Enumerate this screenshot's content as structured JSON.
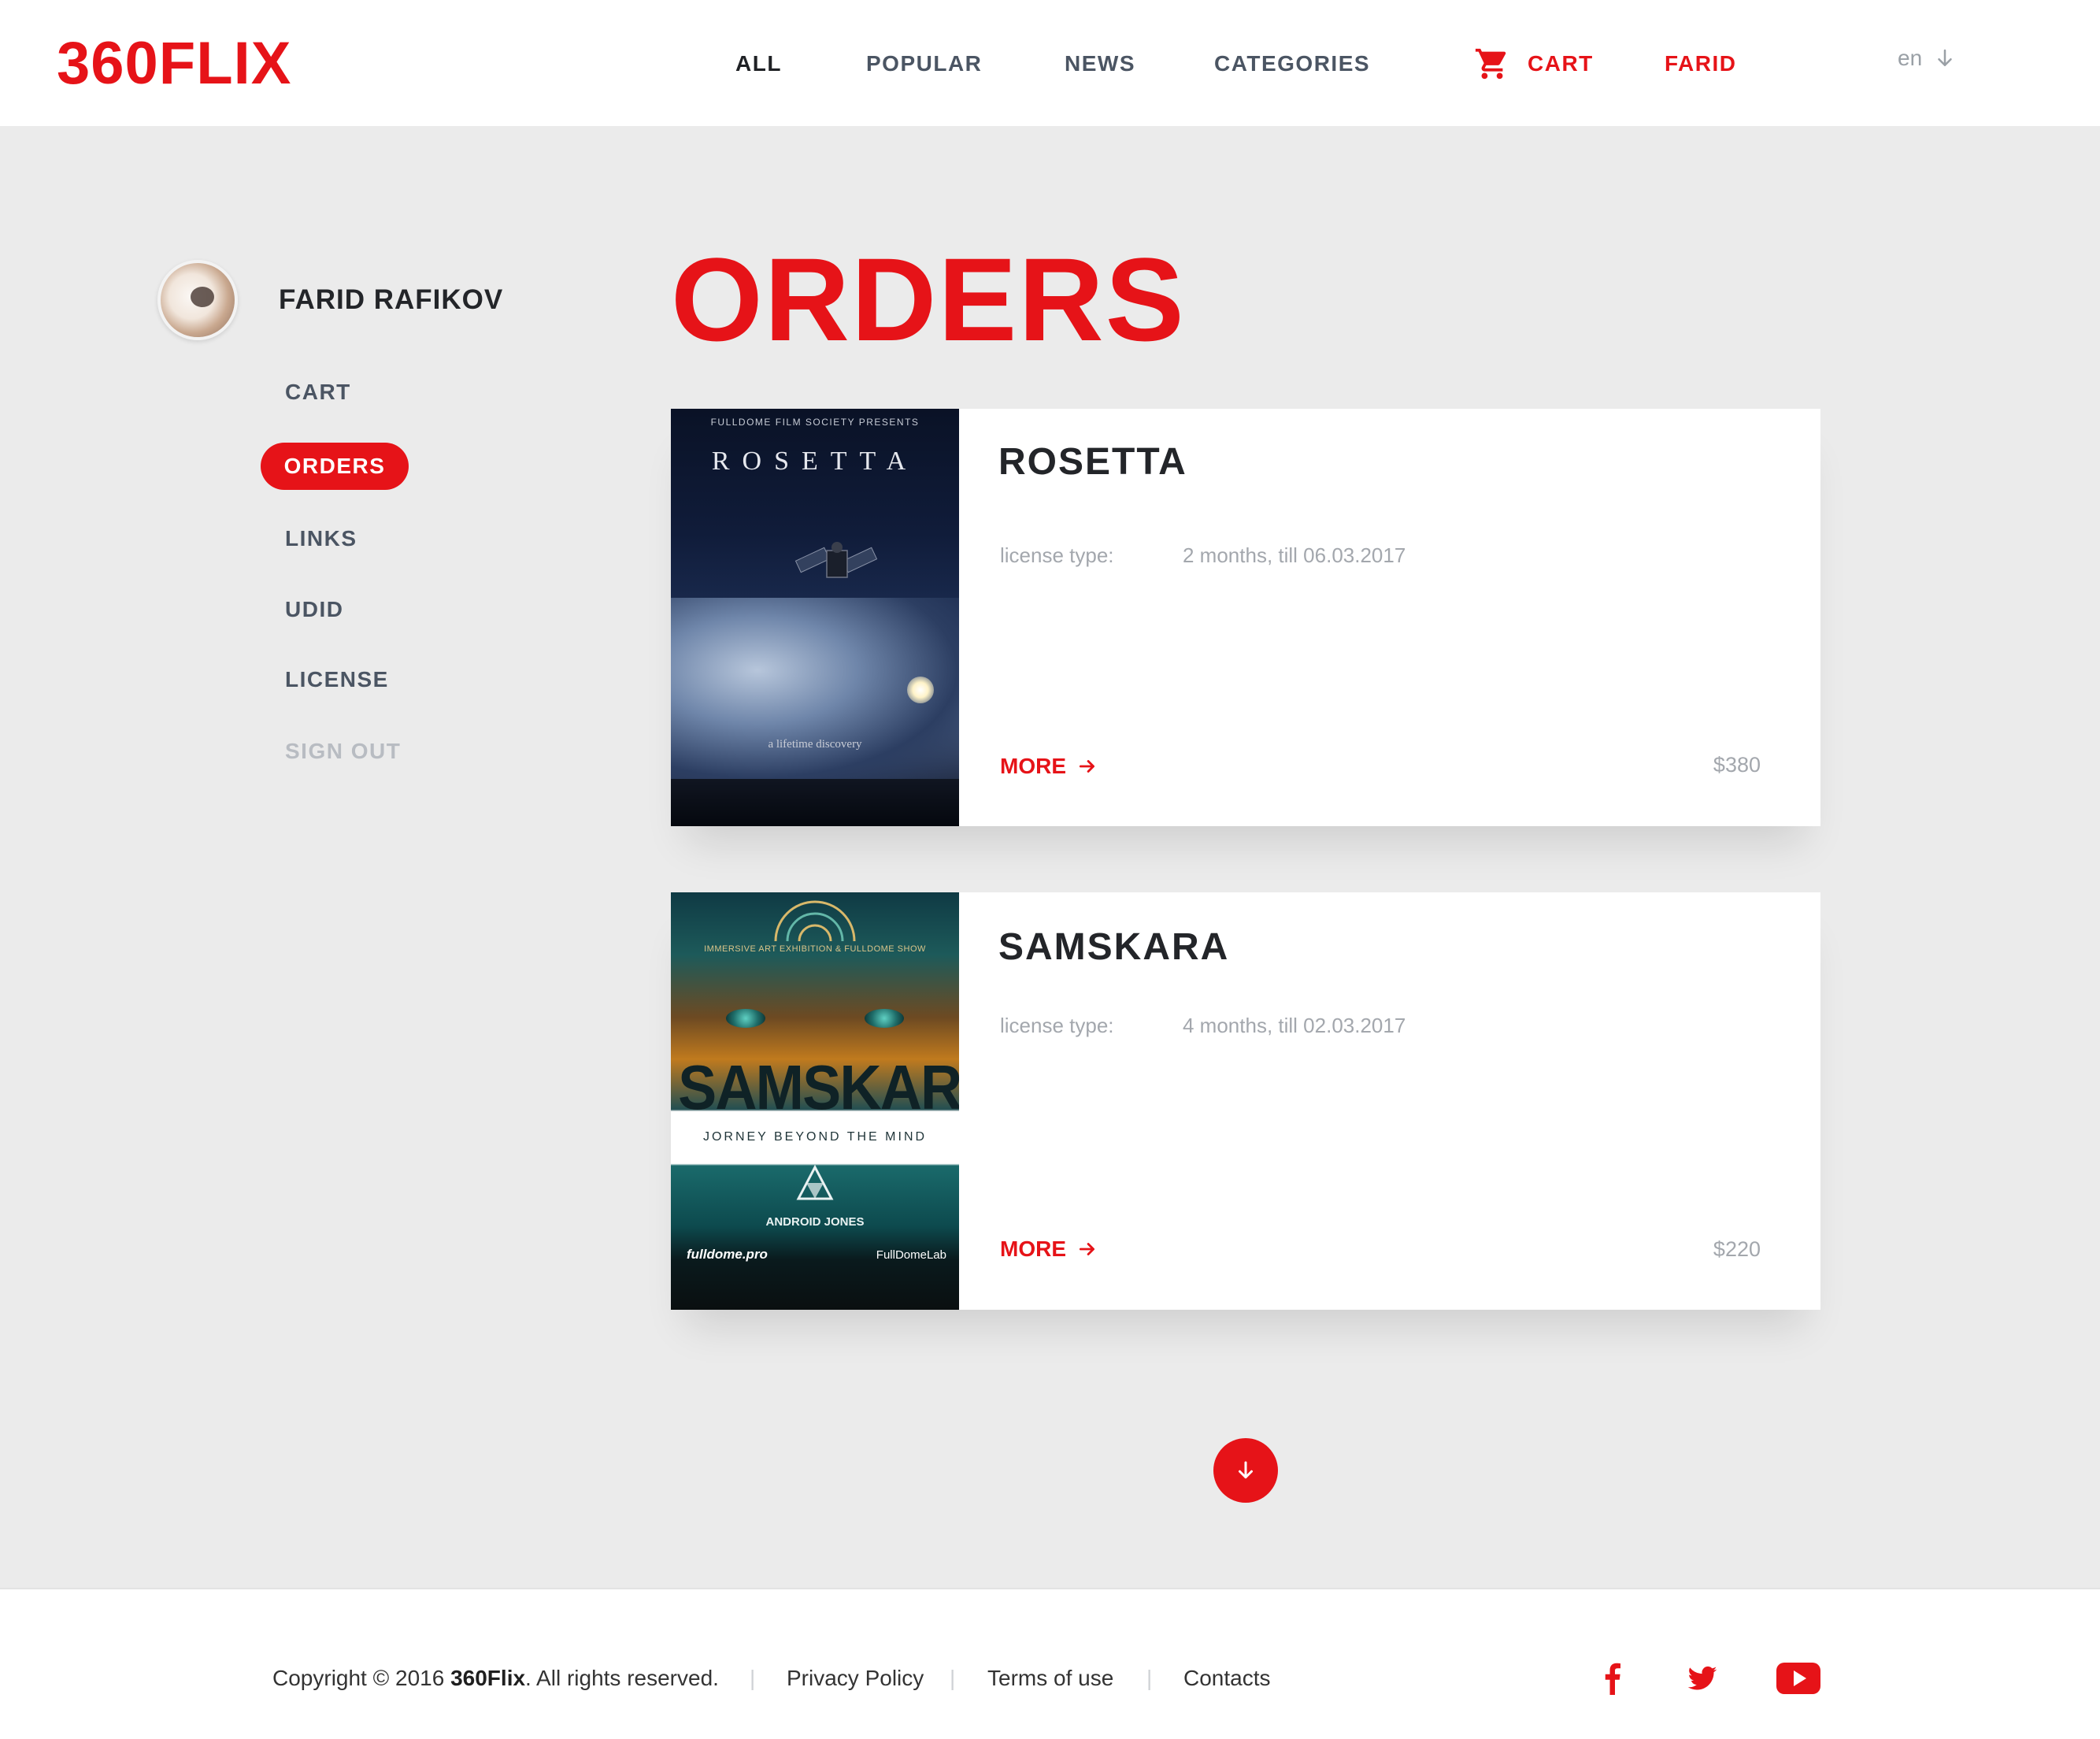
{
  "app": {
    "logo": "360FLIX",
    "accent_color": "#e61318"
  },
  "nav": {
    "items": [
      {
        "label": "ALL",
        "active": true
      },
      {
        "label": "POPULAR"
      },
      {
        "label": "NEWS"
      },
      {
        "label": "CATEGORIES"
      }
    ],
    "cart_label": "CART",
    "cart_icon": "cart-icon",
    "user_label": "FARID",
    "language": "en",
    "language_icon": "arrow-down-icon"
  },
  "sidebar": {
    "user_name": "FARID RAFIKOV",
    "items": [
      {
        "label": "CART"
      },
      {
        "label": "ORDERS",
        "active": true
      },
      {
        "label": "LINKS"
      },
      {
        "label": "UDID"
      },
      {
        "label": "LICENSE"
      },
      {
        "label": "SIGN OUT",
        "muted": true
      }
    ]
  },
  "main": {
    "title": "ORDERS",
    "orders": [
      {
        "title": "ROSETTA",
        "license_label": "license type:",
        "license_value": "2 months, till 06.03.2017",
        "more_label": "MORE",
        "price": "$380",
        "poster": {
          "top_text": "FULLDOME FILM SOCIETY PRESENTS",
          "name": "ROSETTA",
          "tagline": "a lifetime discovery"
        }
      },
      {
        "title": "SAMSKARA",
        "license_label": "license type:",
        "license_value": "4 months, till 02.03.2017",
        "more_label": "MORE",
        "price": "$220",
        "poster": {
          "sub_text": "IMMERSIVE ART EXHIBITION & FULLDOME SHOW",
          "name": "SAMSKARA",
          "tagline": "JORNEY BEYOND THE MIND",
          "artist": "ANDROID JONES",
          "logo_left": "fulldome.pro",
          "logo_right": "FullDomeLab"
        }
      }
    ],
    "scroll_icon": "arrow-down-icon"
  },
  "footer": {
    "copyright_prefix": "Copyright © 2016 ",
    "copyright_brand": "360Flix",
    "copyright_suffix": ". All rights reserved.",
    "separator": "|",
    "links": [
      "Privacy Policy",
      "Terms of use",
      "Contacts"
    ],
    "social": [
      "facebook-icon",
      "twitter-icon",
      "youtube-icon"
    ]
  }
}
